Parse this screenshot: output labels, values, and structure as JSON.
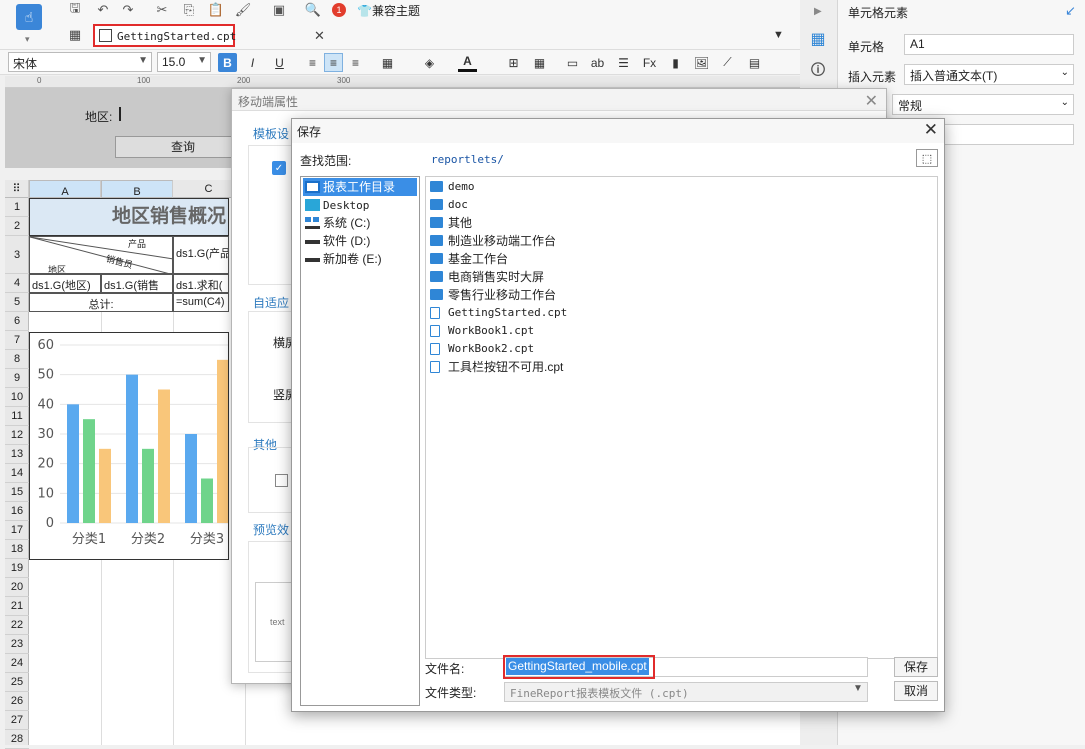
{
  "toolbar": {
    "theme_label": "兼容主题",
    "badge": "1"
  },
  "file_tab": {
    "name": "GettingStarted.cpt"
  },
  "format_bar": {
    "font": "宋体",
    "size": "15.0",
    "bold": "B",
    "italic": "I",
    "underline": "U"
  },
  "ruler_ticks": [
    "0",
    "100",
    "200",
    "300"
  ],
  "param_pane": {
    "region_label": "地区:",
    "query_button": "查询"
  },
  "sheet": {
    "columns": [
      "A",
      "B",
      "C"
    ],
    "rows": [
      "1",
      "2",
      "3",
      "4",
      "5",
      "6",
      "7",
      "8",
      "9",
      "10",
      "11",
      "12",
      "13",
      "14",
      "15",
      "16",
      "17",
      "18",
      "19",
      "20",
      "21",
      "22",
      "23",
      "24",
      "25",
      "26",
      "27",
      "28"
    ],
    "title": "地区销售概况",
    "header_product": "产品",
    "header_sales": "销售员",
    "header_region": "地区",
    "c3": "ds1.G(产品",
    "a4": "ds1.G(地区)",
    "b4": "ds1.G(销售",
    "c4": "ds1.求和(",
    "total_label": "总计:",
    "c5": "=sum(C4)"
  },
  "chart_data": {
    "type": "bar",
    "categories": [
      "分类1",
      "分类2",
      "分类3"
    ],
    "series": [
      {
        "values": [
          40,
          50,
          30
        ]
      },
      {
        "values": [
          35,
          25,
          15
        ]
      },
      {
        "values": [
          25,
          45,
          55
        ]
      }
    ],
    "ylim": [
      0,
      60
    ],
    "yticks": [
      "0",
      "10",
      "20",
      "30",
      "40",
      "50",
      "60"
    ],
    "colors": [
      "#5aa9ef",
      "#6fd48b",
      "#f9c67a"
    ]
  },
  "right_panel": {
    "title": "单元格元素",
    "cell_label": "单元格",
    "cell_value": "A1",
    "insert_label": "插入元素",
    "insert_value": "插入普通文本(T)",
    "format_value": "常规"
  },
  "mobile_dialog": {
    "title": "移动端属性",
    "sec_template": "模板设",
    "sec_adapt": "自适应",
    "horiz": "横屏",
    "vert": "竖屏",
    "sec_other": "其他",
    "sec_preview": "预览效",
    "preview_text": "text"
  },
  "save_dialog": {
    "title": "保存",
    "lookin_label": "查找范围:",
    "path": "reportlets/",
    "places": [
      "报表工作目录",
      "Desktop",
      "系统 (C:)",
      "软件 (D:)",
      "新加卷 (E:)"
    ],
    "files": [
      "demo",
      "doc",
      "其他",
      "制造业移动端工作台",
      "基金工作台",
      "电商销售实时大屏",
      "零售行业移动工作台",
      "GettingStarted.cpt",
      "WorkBook1.cpt",
      "WorkBook2.cpt",
      "工具栏按钮不可用.cpt"
    ],
    "filename_label": "文件名:",
    "filename_value": "GettingStarted_mobile.cpt",
    "filetype_label": "文件类型:",
    "filetype_value": "FineReport报表模板文件 (.cpt)",
    "save_button": "保存",
    "cancel_button": "取消"
  }
}
